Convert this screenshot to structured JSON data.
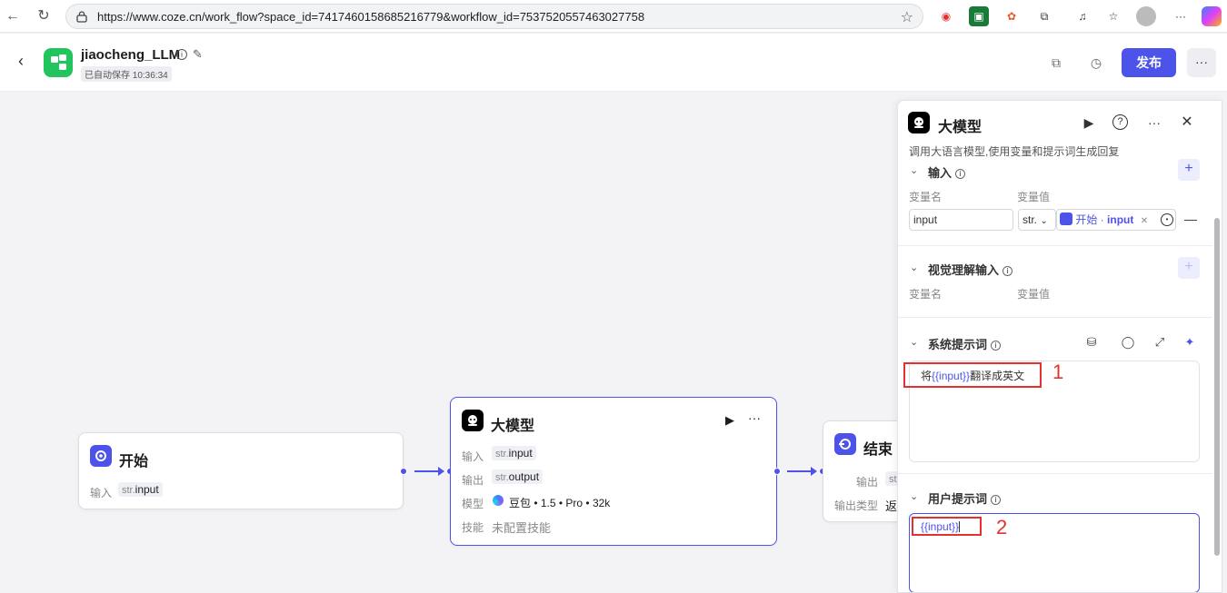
{
  "browser": {
    "url": "https://www.coze.cn/work_flow?space_id=7417460158685216779&workflow_id=7537520557463027758"
  },
  "header": {
    "title": "jiaocheng_LLM",
    "saved_status": "已自动保存 10:36:34",
    "publish_label": "发布",
    "more_label": "···"
  },
  "canvas": {
    "start_node": {
      "title": "开始",
      "input_label": "输入",
      "input_type": "str.",
      "input_name": "input"
    },
    "llm_node": {
      "title": "大模型",
      "input_label": "输入",
      "input_type": "str.",
      "input_name": "input",
      "output_label": "输出",
      "output_type": "str.",
      "output_name": "output",
      "model_label": "模型",
      "model_value": "豆包 • 1.5 • Pro • 32k",
      "skill_label": "技能",
      "skill_value": "未配置技能"
    },
    "end_node": {
      "title": "结束",
      "output_label": "输出",
      "output_type": "str",
      "output_type_label": "输出类型",
      "output_type_value": "返"
    }
  },
  "panel": {
    "title": "大模型",
    "description": "调用大语言模型,使用变量和提示词生成回复",
    "input_section": {
      "title": "输入",
      "col_name": "变量名",
      "col_value": "变量值",
      "var_name": "input",
      "var_type": "str.",
      "ref_node": "开始",
      "ref_sep": " · ",
      "ref_var": "input"
    },
    "vision_section": {
      "title": "视觉理解输入",
      "col_name": "变量名",
      "col_value": "变量值"
    },
    "system_prompt": {
      "title": "系统提示词",
      "prefix": "将",
      "variable": "{{input}}",
      "suffix": "翻译成英文"
    },
    "user_prompt": {
      "title": "用户提示词",
      "variable": "{{input}}"
    }
  },
  "annotations": {
    "label_1": "1",
    "label_2": "2"
  },
  "colors": {
    "accent": "#4d53e8",
    "annotation": "#e53030",
    "start_node_icon": "#4d53e8",
    "app_logo": "#21c45d"
  }
}
